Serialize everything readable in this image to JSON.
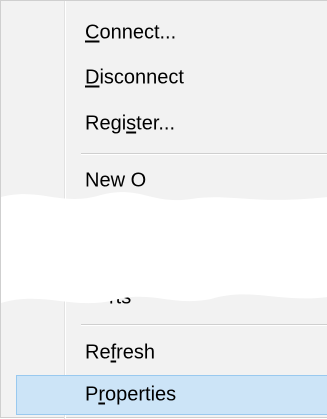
{
  "menu": {
    "items": [
      {
        "prefix": "",
        "accel": "C",
        "suffix": "onnect..."
      },
      {
        "prefix": "",
        "accel": "D",
        "suffix": "isconnect"
      },
      {
        "prefix": "Regi",
        "accel": "s",
        "suffix": "ter..."
      },
      {
        "prefix": "New O",
        "accel": "",
        "suffix": ""
      },
      {
        "prefix": "Re",
        "accel": "f",
        "suffix": "resh"
      },
      {
        "prefix": "P",
        "accel": "r",
        "suffix": "operties"
      }
    ],
    "partial_label": "rts",
    "highlight_color": "#cce4f7",
    "highlight_border": "#99c9ef"
  }
}
